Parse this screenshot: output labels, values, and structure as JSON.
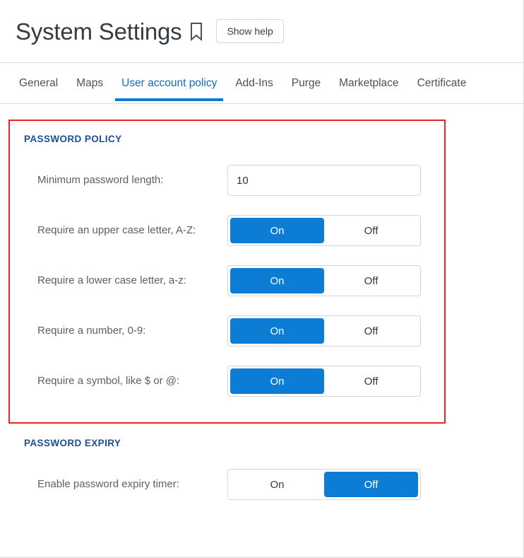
{
  "header": {
    "title": "System Settings",
    "bookmark_icon": "bookmark-icon",
    "show_help_label": "Show help"
  },
  "tabs": {
    "items": [
      {
        "label": "General",
        "active": false
      },
      {
        "label": "Maps",
        "active": false
      },
      {
        "label": "User account policy",
        "active": true
      },
      {
        "label": "Add-Ins",
        "active": false
      },
      {
        "label": "Purge",
        "active": false
      },
      {
        "label": "Marketplace",
        "active": false
      },
      {
        "label": "Certificate",
        "active": false
      }
    ]
  },
  "toggle_options": {
    "on": "On",
    "off": "Off"
  },
  "sections": [
    {
      "title": "PASSWORD POLICY",
      "highlighted": true,
      "rows": [
        {
          "label": "Minimum password length:",
          "control": "input",
          "value": "10",
          "placeholder": ""
        },
        {
          "label": "Require an upper case letter, A-Z:",
          "control": "toggle",
          "value": "On"
        },
        {
          "label": "Require a lower case letter, a-z:",
          "control": "toggle",
          "value": "On"
        },
        {
          "label": "Require a number, 0-9:",
          "control": "toggle",
          "value": "On"
        },
        {
          "label": "Require a symbol, like $ or @:",
          "control": "toggle",
          "value": "On"
        }
      ]
    },
    {
      "title": "PASSWORD EXPIRY",
      "highlighted": false,
      "rows": [
        {
          "label": "Enable password expiry timer:",
          "control": "toggle",
          "value": "Off"
        }
      ]
    }
  ],
  "colors": {
    "accent_blue": "#0c7cd5",
    "tab_active": "#0f6cbd",
    "section_heading": "#1f4e96",
    "highlight_red": "#ee2222",
    "label_gray": "#5a6065"
  }
}
